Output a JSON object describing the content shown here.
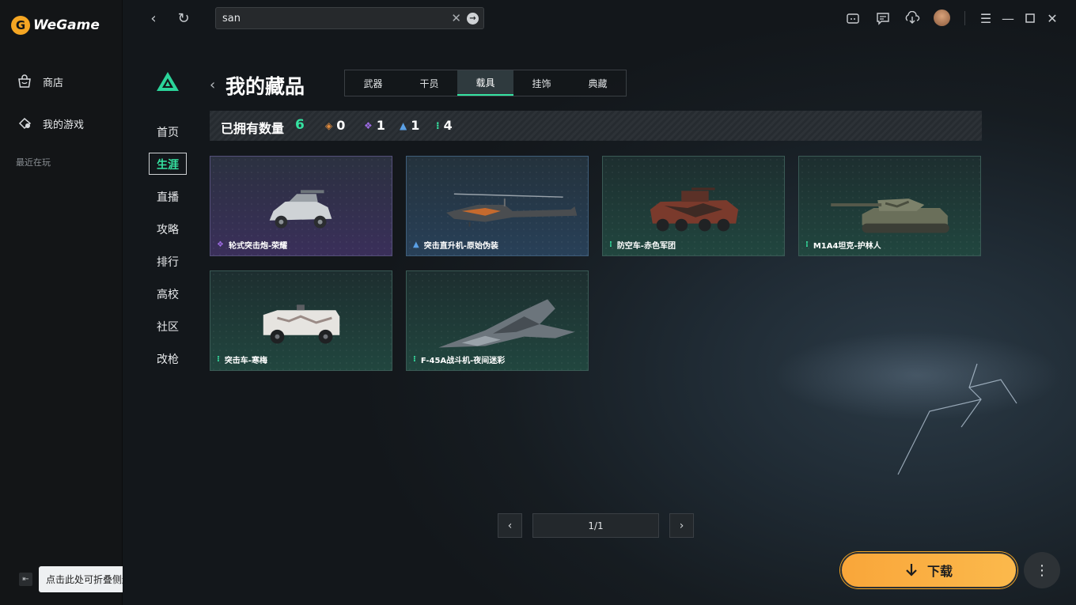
{
  "app": {
    "name": "WeGame"
  },
  "sidebar": {
    "items": [
      {
        "label": "商店",
        "icon": "store-icon"
      },
      {
        "label": "我的游戏",
        "icon": "my-games-icon"
      }
    ],
    "recent_label": "最近在玩",
    "collapse_tooltip": "点击此处可折叠侧边栏"
  },
  "search": {
    "value": "san"
  },
  "game_nav": [
    "首页",
    "生涯",
    "直播",
    "攻略",
    "排行",
    "高校",
    "社区",
    "改枪"
  ],
  "game_nav_active": "生涯",
  "page": {
    "title": "我的藏品"
  },
  "tabs": [
    "武器",
    "干员",
    "载具",
    "挂饰",
    "典藏"
  ],
  "active_tab": "载具",
  "counts": {
    "label": "已拥有数量",
    "total": "6",
    "rarities": [
      {
        "icon": "orange-diamond-icon",
        "color": "#e08a3c",
        "value": "0"
      },
      {
        "icon": "purple-diamond-icon",
        "color": "#9b6ae0",
        "value": "1"
      },
      {
        "icon": "blue-triangle-icon",
        "color": "#5aa0e6",
        "value": "1"
      },
      {
        "icon": "green-dots-icon",
        "color": "#35e2a1",
        "value": "4"
      }
    ]
  },
  "cards": [
    {
      "name": "轮式突击炮-荣耀",
      "rarity": "purple",
      "icon": "purple-diamond-icon",
      "kind": "armored-car"
    },
    {
      "name": "突击直升机-原始伪装",
      "rarity": "blue",
      "icon": "blue-triangle-icon",
      "kind": "helicopter"
    },
    {
      "name": "防空车-赤色军团",
      "rarity": "green",
      "icon": "green-dots-icon",
      "kind": "apc"
    },
    {
      "name": "M1A4坦克-护林人",
      "rarity": "green",
      "icon": "green-dots-icon",
      "kind": "tank"
    },
    {
      "name": "突击车-寒梅",
      "rarity": "green",
      "icon": "green-dots-icon",
      "kind": "assault-vehicle"
    },
    {
      "name": "F-45A战斗机-夜间迷彩",
      "rarity": "green",
      "icon": "green-dots-icon",
      "kind": "fighter-jet"
    }
  ],
  "pagination": {
    "text": "1/1"
  },
  "download": {
    "label": "下载"
  },
  "colors": {
    "accent": "#35e2a1",
    "download": "#f9a63a"
  }
}
